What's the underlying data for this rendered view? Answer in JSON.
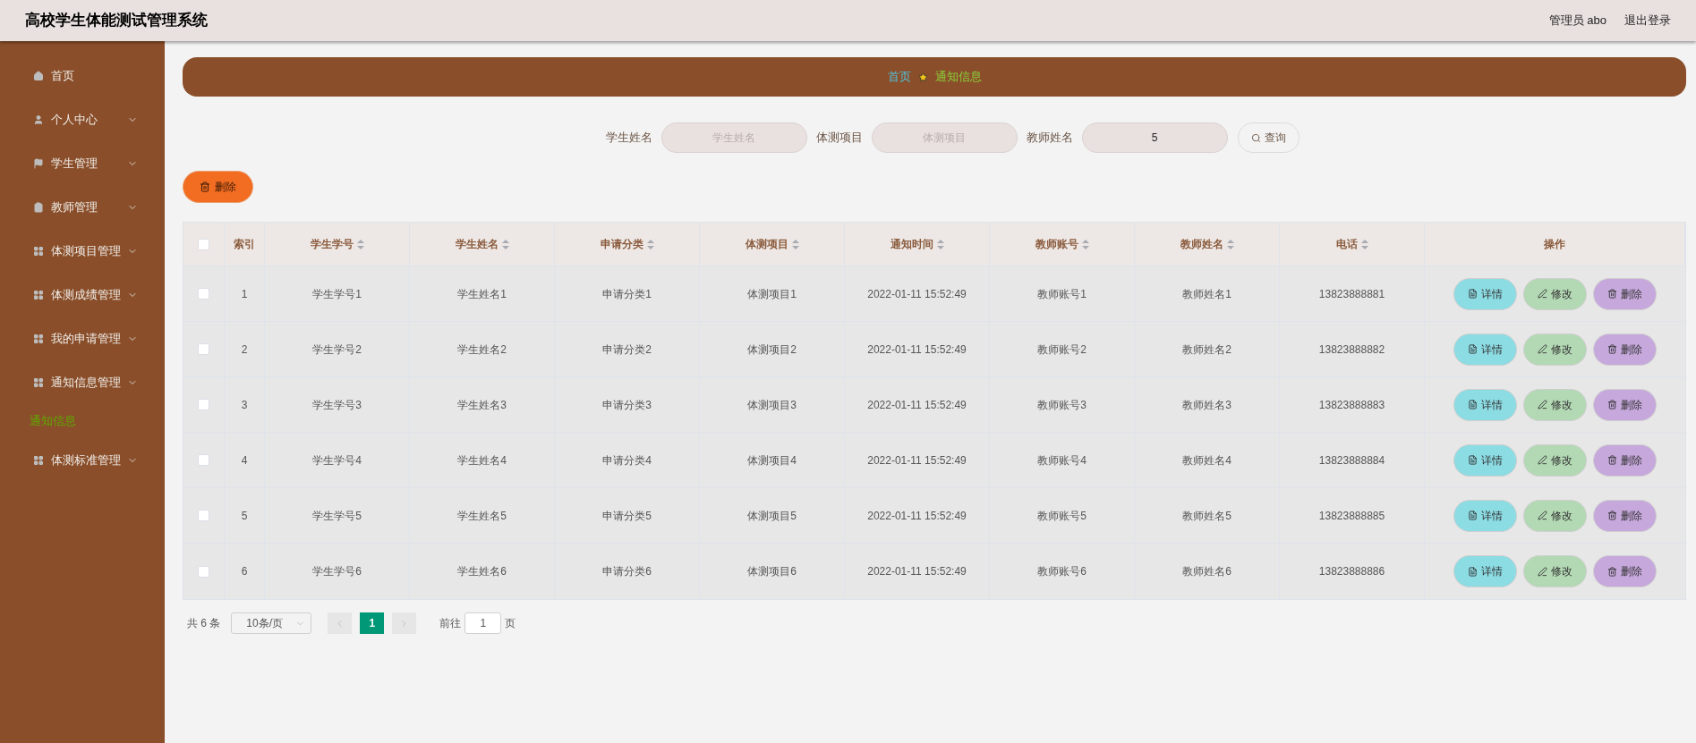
{
  "header": {
    "title": "高校学生体能测试管理系统",
    "user": "管理员 abo",
    "logout": "退出登录"
  },
  "sidebar": {
    "items": [
      {
        "label": "首页",
        "expandable": false,
        "selected": false
      },
      {
        "label": "个人中心",
        "expandable": true,
        "selected": false
      },
      {
        "label": "学生管理",
        "expandable": true,
        "selected": false
      },
      {
        "label": "教师管理",
        "expandable": true,
        "selected": false
      },
      {
        "label": "体测项目管理",
        "expandable": true,
        "selected": false
      },
      {
        "label": "体测成绩管理",
        "expandable": true,
        "selected": false
      },
      {
        "label": "我的申请管理",
        "expandable": true,
        "selected": false
      },
      {
        "label": "通知信息管理",
        "expandable": true,
        "selected": false,
        "children": [
          {
            "label": "通知信息",
            "selected": true
          }
        ]
      },
      {
        "label": "体测标准管理",
        "expandable": true,
        "selected": false
      }
    ]
  },
  "breadcrumb": [
    {
      "label": "首页",
      "kind": "link"
    },
    {
      "label": "通知信息",
      "kind": "current"
    }
  ],
  "search": {
    "fields": [
      {
        "label": "学生姓名",
        "placeholder": "学生姓名"
      },
      {
        "label": "体测项目",
        "placeholder": "体测项目"
      },
      {
        "label": "教师姓名",
        "value": "5"
      }
    ],
    "button": "查询"
  },
  "bulk_delete": "删除",
  "table": {
    "columns": [
      {
        "label": "索引",
        "sortable": false
      },
      {
        "label": "学生学号",
        "sortable": true
      },
      {
        "label": "学生姓名",
        "sortable": true
      },
      {
        "label": "申请分类",
        "sortable": true
      },
      {
        "label": "体测项目",
        "sortable": true
      },
      {
        "label": "通知时间",
        "sortable": true
      },
      {
        "label": "教师账号",
        "sortable": true
      },
      {
        "label": "教师姓名",
        "sortable": true
      },
      {
        "label": "电话",
        "sortable": true
      },
      {
        "label": "操作",
        "sortable": false
      }
    ],
    "header_checked": false,
    "rows": [
      {
        "checked": false,
        "actions": [
          {
            "label": "详情",
            "kind": "detail"
          },
          {
            "label": "修改",
            "kind": "edit"
          },
          {
            "label": "删除",
            "kind": "delete"
          }
        ],
        "cells": [
          "1",
          "学生学号1",
          "学生姓名1",
          "申请分类1",
          "体测项目1",
          "2022-01-11 15:52:49",
          "教师账号1",
          "教师姓名1",
          "13823888881"
        ]
      },
      {
        "checked": false,
        "actions": [
          {
            "label": "详情",
            "kind": "detail"
          },
          {
            "label": "修改",
            "kind": "edit"
          },
          {
            "label": "删除",
            "kind": "delete"
          }
        ],
        "cells": [
          "2",
          "学生学号2",
          "学生姓名2",
          "申请分类2",
          "体测项目2",
          "2022-01-11 15:52:49",
          "教师账号2",
          "教师姓名2",
          "13823888882"
        ]
      },
      {
        "checked": false,
        "actions": [
          {
            "label": "详情",
            "kind": "detail"
          },
          {
            "label": "修改",
            "kind": "edit"
          },
          {
            "label": "删除",
            "kind": "delete"
          }
        ],
        "cells": [
          "3",
          "学生学号3",
          "学生姓名3",
          "申请分类3",
          "体测项目3",
          "2022-01-11 15:52:49",
          "教师账号3",
          "教师姓名3",
          "13823888883"
        ]
      },
      {
        "checked": false,
        "actions": [
          {
            "label": "详情",
            "kind": "detail"
          },
          {
            "label": "修改",
            "kind": "edit"
          },
          {
            "label": "删除",
            "kind": "delete"
          }
        ],
        "cells": [
          "4",
          "学生学号4",
          "学生姓名4",
          "申请分类4",
          "体测项目4",
          "2022-01-11 15:52:49",
          "教师账号4",
          "教师姓名4",
          "13823888884"
        ]
      },
      {
        "checked": false,
        "actions": [
          {
            "label": "详情",
            "kind": "detail"
          },
          {
            "label": "修改",
            "kind": "edit"
          },
          {
            "label": "删除",
            "kind": "delete"
          }
        ],
        "cells": [
          "5",
          "学生学号5",
          "学生姓名5",
          "申请分类5",
          "体测项目5",
          "2022-01-11 15:52:49",
          "教师账号5",
          "教师姓名5",
          "13823888885"
        ]
      },
      {
        "checked": false,
        "actions": [
          {
            "label": "详情",
            "kind": "detail"
          },
          {
            "label": "修改",
            "kind": "edit"
          },
          {
            "label": "删除",
            "kind": "delete"
          }
        ],
        "cells": [
          "6",
          "学生学号6",
          "学生姓名6",
          "申请分类6",
          "体测项目6",
          "2022-01-11 15:52:49",
          "教师账号6",
          "教师姓名6",
          "13823888886"
        ]
      }
    ]
  },
  "pagination": {
    "total": "共 6 条",
    "page_size": "10条/页",
    "pages": [
      {
        "label": "1",
        "selected": true
      }
    ],
    "goto_label": "前往",
    "goto_value": "1",
    "goto_suffix": "页"
  }
}
